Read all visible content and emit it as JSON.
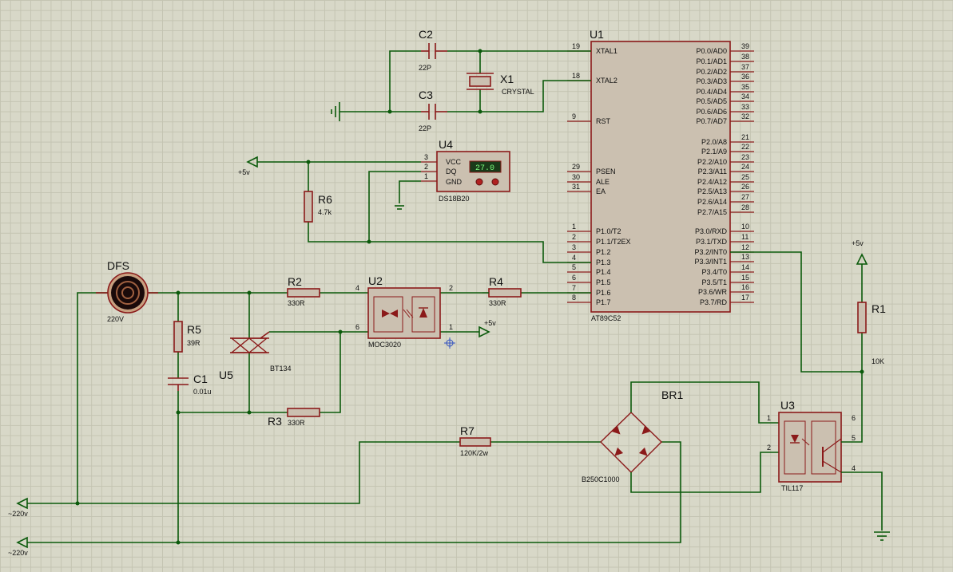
{
  "components": {
    "u1": {
      "ref": "U1",
      "part": "AT89C52",
      "left_pins": [
        {
          "num": "19",
          "name": "XTAL1"
        },
        {
          "num": "18",
          "name": "XTAL2"
        },
        {
          "num": "9",
          "name": "RST"
        },
        {
          "num": "29",
          "name": "PSEN"
        },
        {
          "num": "30",
          "name": "ALE"
        },
        {
          "num": "31",
          "name": "EA"
        },
        {
          "num": "1",
          "name": "P1.0/T2"
        },
        {
          "num": "2",
          "name": "P1.1/T2EX"
        },
        {
          "num": "3",
          "name": "P1.2"
        },
        {
          "num": "4",
          "name": "P1.3"
        },
        {
          "num": "5",
          "name": "P1.4"
        },
        {
          "num": "6",
          "name": "P1.5"
        },
        {
          "num": "7",
          "name": "P1.6"
        },
        {
          "num": "8",
          "name": "P1.7"
        }
      ],
      "right_pins": [
        {
          "num": "39",
          "name": "P0.0/AD0"
        },
        {
          "num": "38",
          "name": "P0.1/AD1"
        },
        {
          "num": "37",
          "name": "P0.2/AD2"
        },
        {
          "num": "36",
          "name": "P0.3/AD3"
        },
        {
          "num": "35",
          "name": "P0.4/AD4"
        },
        {
          "num": "34",
          "name": "P0.5/AD5"
        },
        {
          "num": "33",
          "name": "P0.6/AD6"
        },
        {
          "num": "32",
          "name": "P0.7/AD7"
        },
        {
          "num": "21",
          "name": "P2.0/A8"
        },
        {
          "num": "22",
          "name": "P2.1/A9"
        },
        {
          "num": "23",
          "name": "P2.2/A10"
        },
        {
          "num": "24",
          "name": "P2.3/A11"
        },
        {
          "num": "25",
          "name": "P2.4/A12"
        },
        {
          "num": "26",
          "name": "P2.5/A13"
        },
        {
          "num": "27",
          "name": "P2.6/A14"
        },
        {
          "num": "28",
          "name": "P2.7/A15"
        },
        {
          "num": "10",
          "name": "P3.0/RXD"
        },
        {
          "num": "11",
          "name": "P3.1/TXD"
        },
        {
          "num": "12",
          "name": "P3.2/INT0"
        },
        {
          "num": "13",
          "name": "P3.3/INT1"
        },
        {
          "num": "14",
          "name": "P3.4/T0"
        },
        {
          "num": "15",
          "name": "P3.5/T1"
        },
        {
          "num": "16",
          "name": "P3.6/WR"
        },
        {
          "num": "17",
          "name": "P3.7/RD"
        }
      ]
    },
    "c2": {
      "ref": "C2",
      "value": "22P"
    },
    "c3": {
      "ref": "C3",
      "value": "22P"
    },
    "x1": {
      "ref": "X1",
      "value": "CRYSTAL"
    },
    "u4": {
      "ref": "U4",
      "part": "DS18B20",
      "display": "27.0",
      "pins": [
        {
          "num": "3",
          "name": "VCC"
        },
        {
          "num": "2",
          "name": "DQ"
        },
        {
          "num": "1",
          "name": "GND"
        }
      ]
    },
    "r6": {
      "ref": "R6",
      "value": "4.7k"
    },
    "dfs": {
      "ref": "DFS",
      "value": "220V"
    },
    "r2": {
      "ref": "R2",
      "value": "330R"
    },
    "r4": {
      "ref": "R4",
      "value": "330R"
    },
    "u2": {
      "ref": "U2",
      "part": "MOC3020",
      "pins": {
        "p4": "4",
        "p6": "6",
        "p2": "2",
        "p1": "1"
      }
    },
    "r5": {
      "ref": "R5",
      "value": "39R"
    },
    "c1": {
      "ref": "C1",
      "value": "0.01u"
    },
    "u5": {
      "ref": "U5",
      "part": "BT134"
    },
    "r3": {
      "ref": "R3",
      "value": "330R"
    },
    "r7": {
      "ref": "R7",
      "value": "120K/2w"
    },
    "br1": {
      "ref": "BR1",
      "part": "B250C1000"
    },
    "u3": {
      "ref": "U3",
      "part": "TIL117",
      "pins": {
        "p1": "1",
        "p2": "2",
        "p6": "6",
        "p5": "5",
        "p4": "4"
      }
    },
    "r1": {
      "ref": "R1",
      "value": "10K"
    }
  },
  "terminals": {
    "vcc1": "+5v",
    "vcc2": "+5v",
    "vcc3": "+5v",
    "ac1": "~220v",
    "ac2": "~220v"
  }
}
